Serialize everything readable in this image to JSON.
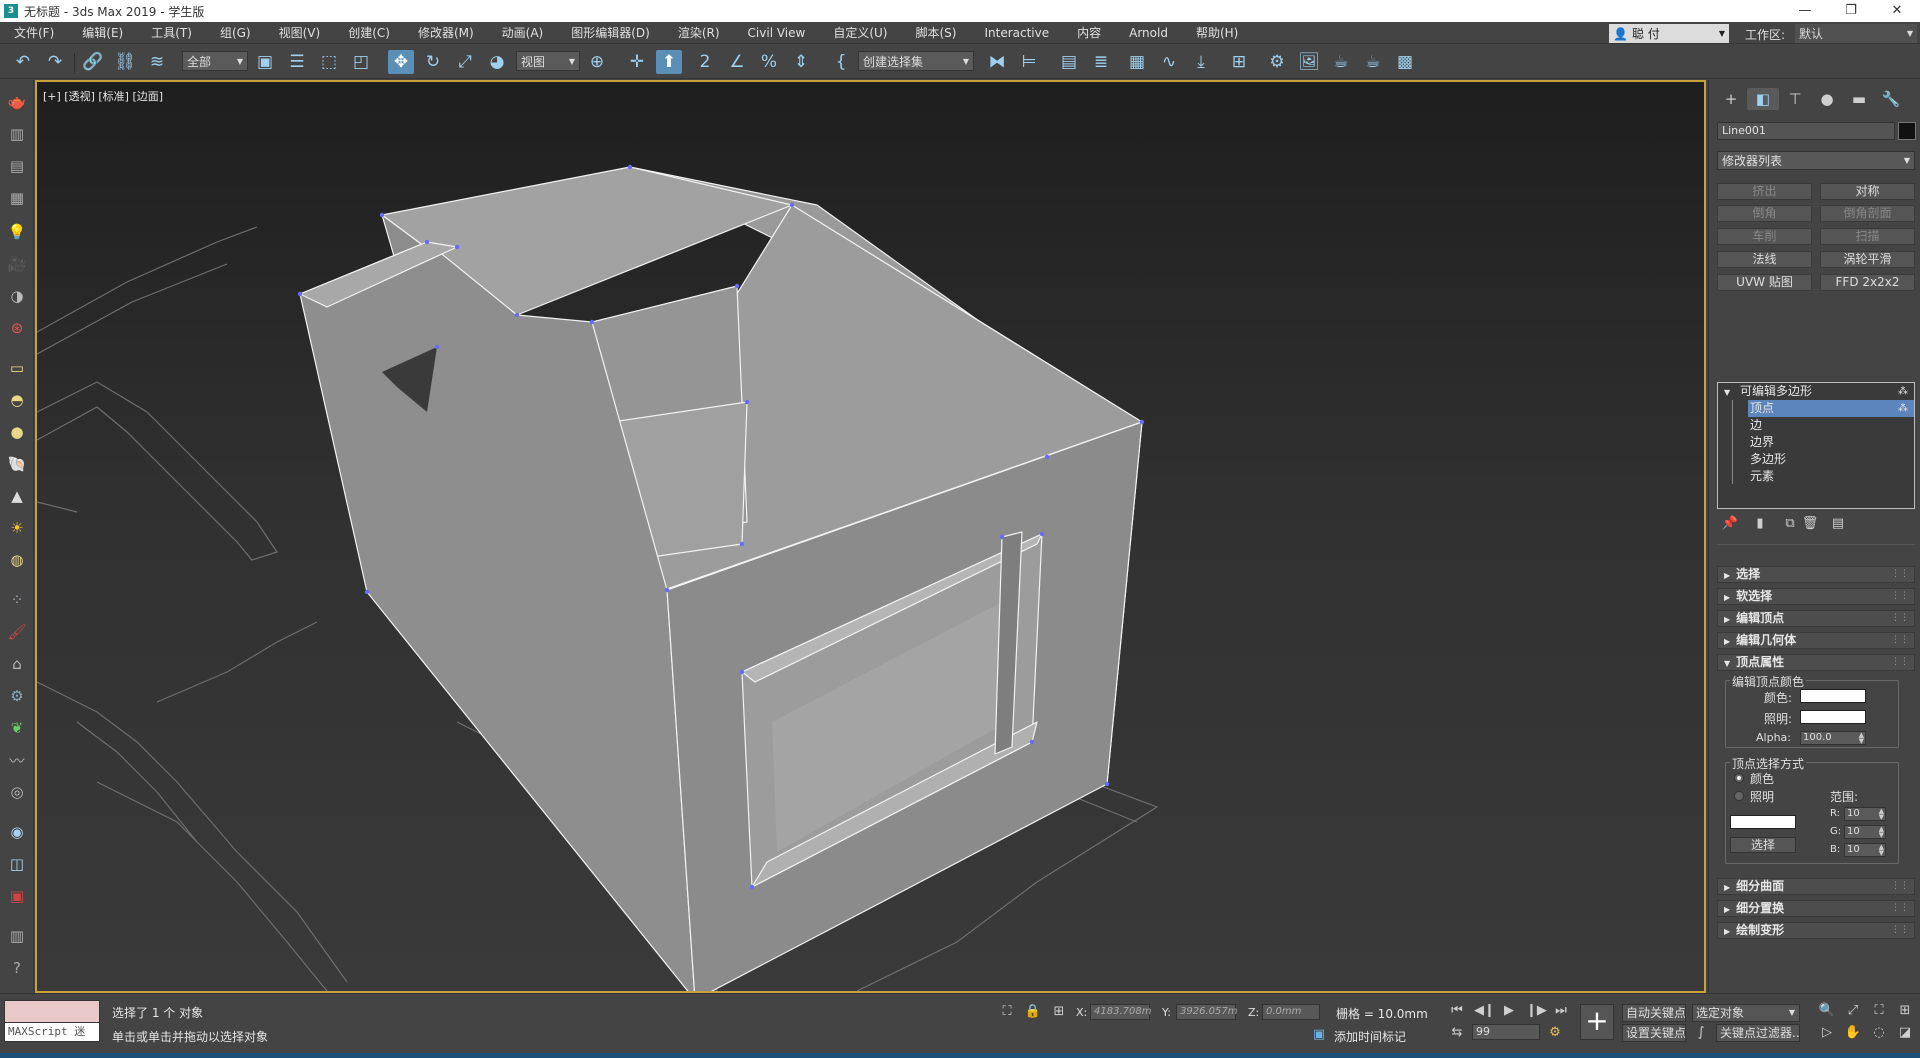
{
  "titlebar": {
    "app_icon": "3",
    "title": "无标题 - 3ds Max 2019 - 学生版",
    "minimize": "—",
    "maximize": "❐",
    "close": "✕"
  },
  "menubar": {
    "items": [
      "文件(F)",
      "编辑(E)",
      "工具(T)",
      "组(G)",
      "视图(V)",
      "创建(C)",
      "修改器(M)",
      "动画(A)",
      "图形编辑器(D)",
      "渲染(R)",
      "Civil View",
      "自定义(U)",
      "脚本(S)",
      "Interactive",
      "内容",
      "Arnold",
      "帮助(H)"
    ],
    "user": "聪 付",
    "workspace_label": "工作区:",
    "workspace_value": "默认"
  },
  "toolbar": {
    "selection_filter": "全部",
    "ref_coord": "视图",
    "named_selection": "创建选择集"
  },
  "viewport": {
    "label": "[+] [透视] [标准] [边面]"
  },
  "command_panel": {
    "object_name": "Line001",
    "object_color": "#111111",
    "modifier_list": "修改器列表",
    "buttons": [
      {
        "label": "挤出",
        "enabled": false
      },
      {
        "label": "对称",
        "enabled": true
      },
      {
        "label": "倒角",
        "enabled": false
      },
      {
        "label": "倒角剖面",
        "enabled": false
      },
      {
        "label": "车削",
        "enabled": false
      },
      {
        "label": "扫描",
        "enabled": false
      },
      {
        "label": "法线",
        "enabled": true
      },
      {
        "label": "涡轮平滑",
        "enabled": true
      },
      {
        "label": "UVW 贴图",
        "enabled": true
      },
      {
        "label": "FFD 2x2x2",
        "enabled": true
      }
    ],
    "stack": {
      "root": "可编辑多边形",
      "children": [
        "顶点",
        "边",
        "边界",
        "多边形",
        "元素"
      ],
      "selected": "顶点"
    },
    "rollouts_top": [
      "选择",
      "软选择",
      "编辑顶点",
      "编辑几何体"
    ],
    "vertex_props": {
      "title": "顶点属性",
      "group1_title": "编辑顶点颜色",
      "color_label": "颜色:",
      "illum_label": "照明:",
      "alpha_label": "Alpha:",
      "alpha_value": "100.0",
      "group2_title": "顶点选择方式",
      "radio_color": "颜色",
      "radio_illum": "照明",
      "range_label": "范围:",
      "r_label": "R:",
      "g_label": "G:",
      "b_label": "B:",
      "r_value": "10",
      "g_value": "10",
      "b_value": "10",
      "select_btn": "选择"
    },
    "rollouts_bottom": [
      "细分曲面",
      "细分置换",
      "绘制变形"
    ]
  },
  "statusbar": {
    "maxscript_label": "MAXScript 迷",
    "status1": "选择了 1 个 对象",
    "status2": "单击或单击并拖动以选择对象",
    "x_label": "X:",
    "x_value": "4183.708m",
    "y_label": "Y:",
    "y_value": "3926.057m",
    "z_label": "Z:",
    "z_value": "0.0mm",
    "grid": "栅格 = 10.0mm",
    "add_time_tag": "添加时间标记",
    "auto_key": "自动关键点",
    "set_key": "设置关键点",
    "key_target": "选定对象",
    "key_filter": "关键点过滤器...",
    "frame": "99"
  }
}
